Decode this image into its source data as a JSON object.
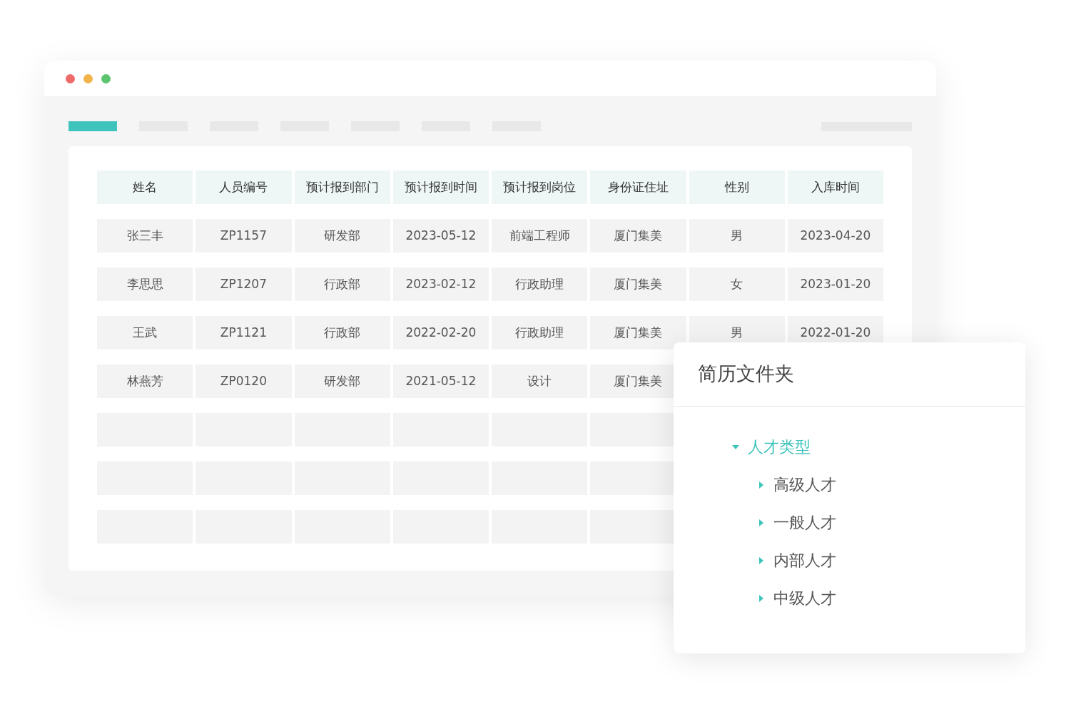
{
  "window": {
    "controls": [
      {
        "color": "#ef6b6b"
      },
      {
        "color": "#f0b44a"
      },
      {
        "color": "#5cc46c"
      }
    ]
  },
  "tabs": [
    {
      "selected": true
    },
    {
      "selected": false
    },
    {
      "selected": false
    },
    {
      "selected": false
    },
    {
      "selected": false
    },
    {
      "selected": false
    },
    {
      "selected": false
    }
  ],
  "table": {
    "columns": [
      "姓名",
      "人员编号",
      "预计报到部门",
      "预计报到时间",
      "预计报到岗位",
      "身份证住址",
      "性别",
      "入库时间"
    ],
    "rows": [
      {
        "cells": [
          "张三丰",
          "ZP1157",
          "研发部",
          "2023-05-12",
          "前端工程师",
          "厦门集美",
          "男",
          "2023-04-20"
        ]
      },
      {
        "cells": [
          "李思思",
          "ZP1207",
          "行政部",
          "2023-02-12",
          "行政助理",
          "厦门集美",
          "女",
          "2023-01-20"
        ]
      },
      {
        "cells": [
          "王武",
          "ZP1121",
          "行政部",
          "2022-02-20",
          "行政助理",
          "厦门集美",
          "男",
          "2022-01-20"
        ]
      },
      {
        "cells": [
          "林燕芳",
          "ZP0120",
          "研发部",
          "2021-05-12",
          "设计",
          "厦门集美"
        ]
      }
    ]
  },
  "folder_panel": {
    "title": "简历文件夹",
    "tree": [
      {
        "label": "人才类型",
        "expanded": true,
        "children": [
          {
            "label": "高级人才",
            "expanded": false
          },
          {
            "label": "一般人才",
            "expanded": false
          },
          {
            "label": "内部人才",
            "expanded": false
          },
          {
            "label": "中级人才",
            "expanded": false
          }
        ]
      }
    ]
  }
}
